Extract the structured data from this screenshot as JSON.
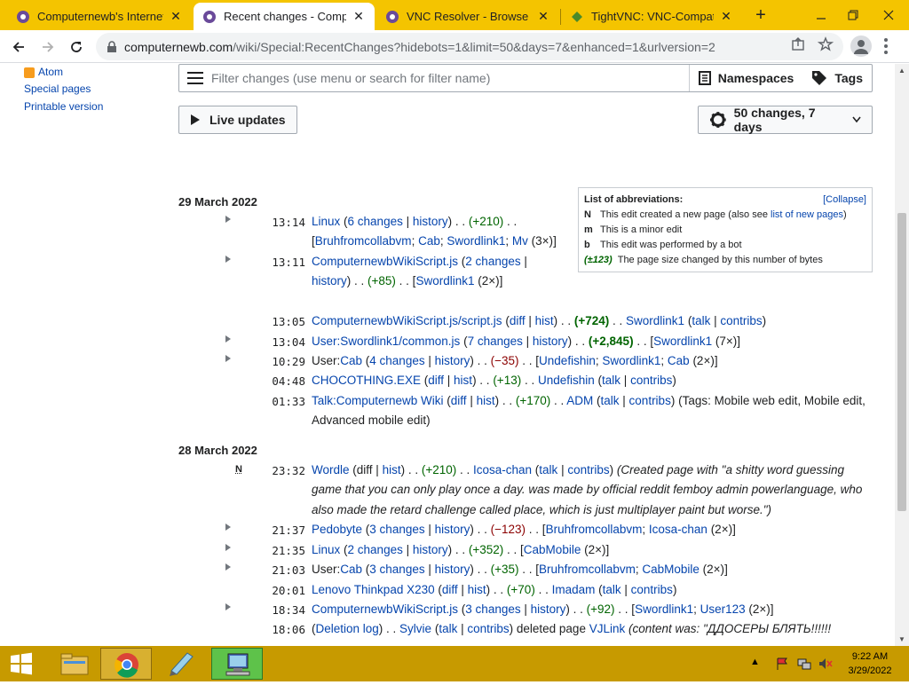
{
  "browser": {
    "tabs": [
      {
        "title": "Computernewb's Internet P",
        "close": "✕"
      },
      {
        "title": "Recent changes - Compute",
        "close": "✕"
      },
      {
        "title": "VNC Resolver - Browse",
        "close": "✕"
      },
      {
        "title": "TightVNC: VNC-Compatib",
        "close": "✕"
      }
    ],
    "new_tab": "+",
    "url_host": "computernewb.com",
    "url_path": "/wiki/Special:RecentChanges?hidebots=1&limit=50&days=7&enhanced=1&urlversion=2"
  },
  "sidebar": {
    "atom": "Atom",
    "special_pages": "Special pages",
    "printable": "Printable version"
  },
  "filter": {
    "placeholder": "Filter changes (use menu or search for filter name)",
    "namespaces": "Namespaces",
    "tags": "Tags"
  },
  "live_updates": "Live updates",
  "changes_summary": "50 changes, 7 days",
  "legend": {
    "title": "List of abbreviations:",
    "collapse": "[Collapse]",
    "n_key": "N",
    "n_text": "This edit created a new page (also see ",
    "n_link": "list of new pages",
    "n_close": ")",
    "m_key": "m",
    "m_text": "This is a minor edit",
    "b_key": "b",
    "b_text": "This edit was performed by a bot",
    "size_key": "(±123)",
    "size_text": "The page size changed by this number of bytes"
  },
  "day1": "29 March 2022",
  "day2": "28 March 2022",
  "r1": {
    "time": "13:14",
    "page": "Linux",
    "changes": "6 changes",
    "hist": "history",
    "size": "(+210)",
    "u1": "Bruhfromcollabvm",
    "u2": "Cab",
    "u3": "Swordlink1",
    "u4": "Mv",
    "count": "(3×)"
  },
  "r2": {
    "time": "13:11",
    "page": "ComputernewbWikiScript.js",
    "changes": "2 changes",
    "hist": "history",
    "size": "(+85)",
    "u1": "Swordlink1",
    "count": "(2×)"
  },
  "r3": {
    "time": "13:05",
    "page": "ComputernewbWikiScript.js/script.js",
    "diff": "diff",
    "hist": "hist",
    "size": "(+724)",
    "user": "Swordlink1",
    "talk": "talk",
    "contribs": "contribs"
  },
  "r4": {
    "time": "13:04",
    "page": "User:Swordlink1/common.js",
    "changes": "7 changes",
    "hist": "history",
    "size": "(+2,845)",
    "u1": "Swordlink1",
    "count": "(7×)"
  },
  "r5": {
    "time": "10:29",
    "page_prefix": "User:",
    "page": "Cab",
    "changes": "4 changes",
    "hist": "history",
    "size": "(−35)",
    "u1": "Undefishin",
    "u2": "Swordlink1",
    "u3": "Cab",
    "count": "(2×)"
  },
  "r6": {
    "time": "04:48",
    "page": "CHOCOTHING.EXE",
    "diff": "diff",
    "hist": "hist",
    "size": "(+13)",
    "user": "Undefishin",
    "talk": "talk",
    "contribs": "contribs"
  },
  "r7": {
    "time": "01:33",
    "page": "Talk:Computernewb Wiki",
    "diff": "diff",
    "hist": "hist",
    "size": "(+170)",
    "user": "ADM",
    "talk": "talk",
    "contribs": "contribs",
    "tags": "(Tags: Mobile web edit, Mobile edit, Advanced mobile edit)"
  },
  "r8": {
    "flag": "N",
    "time": "23:32",
    "page": "Wordle",
    "diff": "diff",
    "hist": "hist",
    "size": "(+210)",
    "user": "Icosa-chan",
    "talk": "talk",
    "contribs": "contribs",
    "summary": "(Created page with \"a shitty word guessing game that you can only play once a day. was made by official reddit femboy admin powerlanguage, who also made the retard challenge called place, which is just multiplayer paint but worse.\")"
  },
  "r9": {
    "time": "21:37",
    "page": "Pedobyte",
    "changes": "3 changes",
    "hist": "history",
    "size": "(−123)",
    "u1": "Bruhfromcollabvm",
    "u2": "Icosa-chan",
    "count": "(2×)"
  },
  "r10": {
    "time": "21:35",
    "page": "Linux",
    "changes": "2 changes",
    "hist": "history",
    "size": "(+352)",
    "u1": "CabMobile",
    "count": "(2×)"
  },
  "r11": {
    "time": "21:03",
    "page_prefix": "User:",
    "page": "Cab",
    "changes": "3 changes",
    "hist": "history",
    "size": "(+35)",
    "u1": "Bruhfromcollabvm",
    "u2": "CabMobile",
    "count": "(2×)"
  },
  "r12": {
    "time": "20:01",
    "page": "Lenovo Thinkpad X230",
    "diff": "diff",
    "hist": "hist",
    "size": "(+70)",
    "user": "Imadam",
    "talk": "talk",
    "contribs": "contribs"
  },
  "r13": {
    "time": "18:34",
    "page": "ComputernewbWikiScript.js",
    "changes": "3 changes",
    "hist": "history",
    "size": "(+92)",
    "u1": "Swordlink1",
    "u2": "User123",
    "count": "(2×)"
  },
  "r14": {
    "time": "18:06",
    "log": "Deletion log",
    "user": "Sylvie",
    "talk": "talk",
    "contribs": "contribs",
    "action": "deleted page",
    "target": "VJLink",
    "content": "(content was: \"ДДОСЕРЫ БЛЯТЬ!!!!!!"
  },
  "clock": {
    "time": "9:22 AM",
    "date": "3/29/2022"
  }
}
